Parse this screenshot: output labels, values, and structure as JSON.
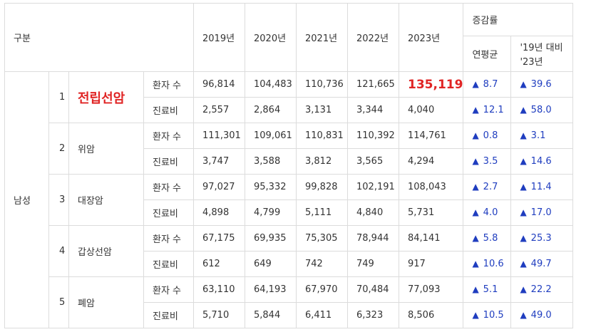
{
  "header": {
    "category": "구분",
    "years": [
      "2019년",
      "2020년",
      "2021년",
      "2022년",
      "2023년"
    ],
    "growth_group": "증감률",
    "growth_annual": "연평균",
    "growth_compare_line1": "'19년 대비",
    "growth_compare_line2": "'23년"
  },
  "group_label": "남성",
  "up_symbol": "▲",
  "cancers": [
    {
      "rank": "1",
      "name": "전립선암",
      "highlight": true,
      "rows": [
        {
          "metric": "환자 수",
          "values": [
            "96,814",
            "104,483",
            "110,736",
            "121,665",
            "135,119"
          ],
          "annual": "8.7",
          "compare": "39.6"
        },
        {
          "metric": "진료비",
          "values": [
            "2,557",
            "2,864",
            "3,131",
            "3,344",
            "4,040"
          ],
          "annual": "12.1",
          "compare": "58.0"
        }
      ]
    },
    {
      "rank": "2",
      "name": "위암",
      "highlight": false,
      "rows": [
        {
          "metric": "환자 수",
          "values": [
            "111,301",
            "109,061",
            "110,831",
            "110,392",
            "114,761"
          ],
          "annual": "0.8",
          "compare": "3.1"
        },
        {
          "metric": "진료비",
          "values": [
            "3,747",
            "3,588",
            "3,812",
            "3,565",
            "4,294"
          ],
          "annual": "3.5",
          "compare": "14.6"
        }
      ]
    },
    {
      "rank": "3",
      "name": "대장암",
      "highlight": false,
      "rows": [
        {
          "metric": "환자 수",
          "values": [
            "97,027",
            "95,332",
            "99,828",
            "102,191",
            "108,043"
          ],
          "annual": "2.7",
          "compare": "11.4"
        },
        {
          "metric": "진료비",
          "values": [
            "4,898",
            "4,799",
            "5,111",
            "4,840",
            "5,731"
          ],
          "annual": "4.0",
          "compare": "17.0"
        }
      ]
    },
    {
      "rank": "4",
      "name": "갑상선암",
      "highlight": false,
      "rows": [
        {
          "metric": "환자 수",
          "values": [
            "67,175",
            "69,935",
            "75,305",
            "78,944",
            "84,141"
          ],
          "annual": "5.8",
          "compare": "25.3"
        },
        {
          "metric": "진료비",
          "values": [
            "612",
            "649",
            "742",
            "749",
            "917"
          ],
          "annual": "10.6",
          "compare": "49.7"
        }
      ]
    },
    {
      "rank": "5",
      "name": "폐암",
      "highlight": false,
      "rows": [
        {
          "metric": "환자 수",
          "values": [
            "63,110",
            "64,193",
            "67,970",
            "70,484",
            "77,093"
          ],
          "annual": "5.1",
          "compare": "22.2"
        },
        {
          "metric": "진료비",
          "values": [
            "5,710",
            "5,844",
            "6,411",
            "6,323",
            "8,506"
          ],
          "annual": "10.5",
          "compare": "49.0"
        }
      ]
    }
  ]
}
